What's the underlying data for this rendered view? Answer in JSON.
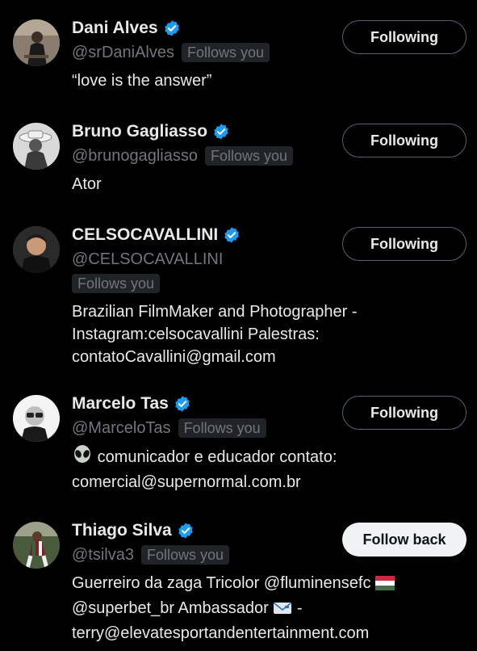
{
  "users": [
    {
      "name": "Dani Alves",
      "handle": "@srDaniAlves",
      "follows_you": "Follows you",
      "button": "Following",
      "bio_lines": [
        "“love is the answer”"
      ]
    },
    {
      "name": "Bruno Gagliasso",
      "handle": "@brunogagliasso",
      "follows_you": "Follows you",
      "button": "Following",
      "bio_lines": [
        "Ator"
      ]
    },
    {
      "name": "CELSOCAVALLINI",
      "handle": "@CELSOCAVALLINI",
      "follows_you": "Follows you",
      "button": "Following",
      "bio_lines": [
        "Brazilian FilmMaker and Photographer -",
        "Instagram:celsocavallini Palestras:",
        "contatoCavallini@gmail.com"
      ]
    },
    {
      "name": "Marcelo Tas",
      "handle": "@MarceloTas",
      "follows_you": "Follows you",
      "button": "Following",
      "bio_lines": [
        "comunicador e educador contato:",
        "comercial@supernormal.com.br"
      ]
    },
    {
      "name": "Thiago Silva",
      "handle": "@tsilva3",
      "follows_you": "Follows you",
      "button": "Follow back",
      "bio_lines": [
        "Guerreiro da zaga Tricolor @fluminensefc",
        "@superbet_br Ambassador",
        "terry@elevatesportandentertainment.com"
      ]
    }
  ],
  "icons": {
    "verified": "verified-badge-icon",
    "alien": "alien-emoji",
    "flag": "hungary-flag-emoji",
    "mail": "envelope-emoji"
  },
  "colors": {
    "background": "#000000",
    "verified": "#1d9bf0",
    "secondary_text": "#71767b",
    "badge_bg": "#202327"
  }
}
